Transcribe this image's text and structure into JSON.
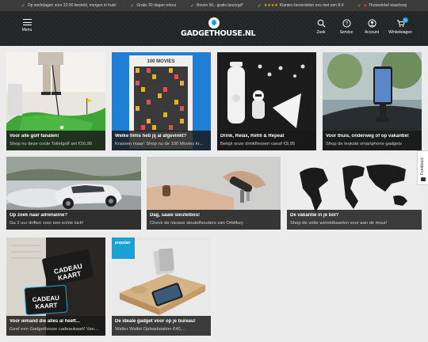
{
  "usps": [
    {
      "text": "Op werkdagen voor 22:00 besteld, morgen in huis!"
    },
    {
      "text": "Gratis 30 dagen retour"
    },
    {
      "text": "Boven 50,- gratis bezorgd*"
    },
    {
      "text": "Klanten beoordelen ons met een 8.4"
    },
    {
      "text": "Thuiswinkel waarborg"
    }
  ],
  "header": {
    "menu_label": "Menu",
    "logo_text": "GADGETHOUSE.NL",
    "icons": {
      "search": "Zoek",
      "service": "Service",
      "account": "Account",
      "cart": "Winkelwagen",
      "cart_count": "0"
    }
  },
  "tiles": [
    {
      "title": "Voor alle golf fanaten!",
      "subtitle": "Shop nu deze coole Toiletgolf set €16,95"
    },
    {
      "title": "Welke films heb jij al afgevinkt?",
      "subtitle": "Krassen maar! Shop nu de 100 Movies kr..."
    },
    {
      "title": "Drink, Relax, Refill & Repeat",
      "subtitle": "Bekijk onze drinkflessen vanaf €9,95"
    },
    {
      "title": "Voor thuis, onderweg of op vakantie!",
      "subtitle": "Shop de leukste smartphone gadgets"
    },
    {
      "title": "Op zoek naar adrenaline?",
      "subtitle": "Ga 2 uur driften voor een echte kick!"
    },
    {
      "title": "Dag, saaie sleutelbos!",
      "subtitle": "Check de nieuwe sleutelhouders van Orbitkey"
    },
    {
      "title": "De vakantie in je bol?",
      "subtitle": "Shop de vette wereldkaarten voor aan de muur!"
    },
    {
      "title": "Voor iemand die alles al heeft...",
      "subtitle": "Geef een Gadgethouse cadeaukaart! Van..."
    },
    {
      "title": "De ideale gadget voor op je bureau!",
      "subtitle": "Walter Wallet Oplaadstation €40,..."
    }
  ],
  "popular_label": "populair",
  "gift_card": {
    "line1": "CADEAU",
    "line2": "KAART"
  },
  "poster_title": "100 MOVIES",
  "feedback_label": "Feedback",
  "colors": {
    "accent": "#1aa1d6",
    "header_bg": "#222426",
    "topbar_bg": "#3c3c3c",
    "check": "#9ccc3c"
  }
}
